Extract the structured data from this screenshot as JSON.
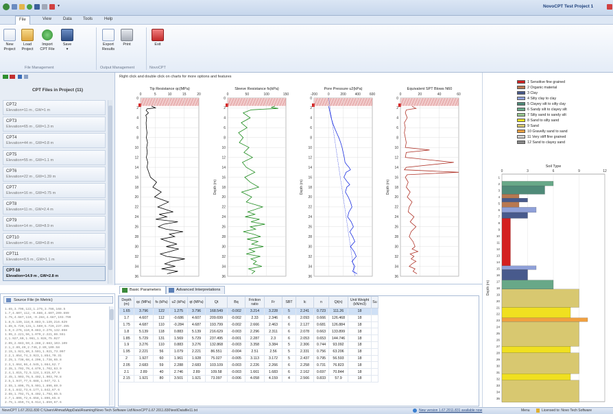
{
  "window": {
    "title": "NovoCPT Test Project 1"
  },
  "menu": [
    "File",
    "View",
    "Data",
    "Tools",
    "Help"
  ],
  "ribbon": {
    "file_management": {
      "label": "File Management",
      "buttons": [
        {
          "line1": "New",
          "line2": "Project"
        },
        {
          "line1": "Load",
          "line2": "Project"
        },
        {
          "line1": "Import",
          "line2": "CPT File"
        },
        {
          "line1": "Save",
          "line2": "▾"
        }
      ]
    },
    "output_management": {
      "label": "Output Management",
      "buttons": [
        {
          "line1": "Export",
          "line2": "Results"
        },
        {
          "line1": "Print",
          "line2": ""
        }
      ]
    },
    "novocpt": {
      "label": "NovoCPT",
      "buttons": [
        {
          "line1": "Exit",
          "line2": ""
        }
      ]
    }
  },
  "left_panel": {
    "title": "CPT Files in Project (11)",
    "files": [
      {
        "name": "CPT2",
        "elevation": "Elevation=11 m , GW=1 m"
      },
      {
        "name": "CPT3",
        "elevation": "Elevation=65 m , GW=1.3 m"
      },
      {
        "name": "CPT4",
        "elevation": "Elevation=44 m , GW=0.8 m"
      },
      {
        "name": "CPT5",
        "elevation": "Elevation=55 m , GW=1.1 m"
      },
      {
        "name": "CPT6",
        "elevation": "Elevation=22 m , GW=1.39 m"
      },
      {
        "name": "CPT7",
        "elevation": "Elevation=16 m , GW=0.75 m"
      },
      {
        "name": "CPT8",
        "elevation": "Elevation=11 m , GW=2.4 m"
      },
      {
        "name": "CPT9",
        "elevation": "Elevation=14 m , GW=8.9 m"
      },
      {
        "name": "CPT10",
        "elevation": "Elevation=16 m , GW=0.8 m"
      },
      {
        "name": "CPT11",
        "elevation": "Elevation=8.5 m , GW=1.1 m"
      },
      {
        "name": "CPT-16",
        "elevation": "Elevation=14.9 m , GW=2.8 m"
      }
    ]
  },
  "source_panel": {
    "title": "Source File (in Metric)",
    "lines": [
      "1.65,3.796,122,1.275,3.786,168.5",
      "1.7,4.607,112,-0.686,4.607,209.699",
      "1.75,4.687,110,-0.284,4.687,193.799",
      "1.8,5.139,118,0.883,5.139,216.629",
      "1.85,5.729,131,1.569,5.729,237.495",
      "1.9,3.276,110,0.883,3.276,132.868",
      "1.95,2.221,56,1.079,2.221,86.551",
      "2,1.927,60,1.961,1.928,75.027",
      "2.05,2.683,59,2.288,2.683,103.109",
      "2.1,2.89,40,2.746,2.89,109.58",
      "2.15,1.921,80,3.501,1.921,73.097",
      "2.2,1.854,74,3.923,1.854,70.31",
      "2.25,1.738,68,4.206,1.738,65.8",
      "2.3,1.664,66,4.545,1.664,62.7",
      "2.35,1.702,70,4.879,1.702,63.9",
      "2.4,1.815,72,5.124,1.815,67.9",
      "2.45,1.903,76,5.402,1.903,70.8",
      "2.5,1.947,77,5.688,1.947,72.1",
      "2.55,1.896,75,5.901,1.896,69.9",
      "2.6,1.842,73,6.177,1.842,67.6",
      "2.65,1.792,71,6.402,1.792,65.5",
      "2.7,1.806,72,6.658,1.806,65.8",
      "2.75,1.859,74,6.914,1.859,67.6",
      "2.8,1.921,77,7.201,1.921,69.7"
    ]
  },
  "chart_hint": "Right click and double click on charts for more options and features",
  "chart_data": [
    {
      "type": "line",
      "title": "Tip Resistance qc(MPa)",
      "xlim": [
        0,
        20
      ],
      "xticks": [
        "0",
        "5",
        "10",
        "15",
        "20"
      ],
      "ylabel": "",
      "ylim": [
        36,
        0
      ],
      "yticks": [
        "0",
        "2",
        "4",
        "6",
        "8",
        "10",
        "12",
        "14",
        "16",
        "18",
        "20",
        "22",
        "24",
        "26",
        "28",
        "30",
        "32",
        "34",
        "36"
      ],
      "color": "#000000",
      "series": [
        {
          "x": [
            3.8,
            4.6,
            5.1,
            2.2,
            1.9,
            2.7,
            1.8,
            2.1,
            1.9,
            2.0,
            2.2,
            2.0,
            2.4,
            2.1,
            2.3,
            2.0,
            2.5,
            2.2,
            2.8,
            3.4,
            5.5,
            4.2,
            7.1,
            4.8,
            9.6,
            5.9,
            11.2,
            6.4,
            9.0,
            5.2,
            12.8,
            7.8,
            6.1,
            8.8,
            14.6,
            9.9,
            11.7,
            7.0,
            9.4,
            12.5,
            8.8,
            13.1,
            10.2,
            6.8,
            9.0,
            15.2,
            10.6,
            8.3,
            11.9,
            7.2,
            12.8,
            9.1
          ],
          "y": [
            1.65,
            1.85,
            2.0,
            2.2,
            2.5,
            3.0,
            3.5,
            4,
            5,
            6,
            7,
            8,
            9,
            10,
            11,
            12,
            13,
            14,
            15,
            16,
            17,
            18,
            19,
            20,
            21,
            22,
            23,
            23.5,
            24,
            24.5,
            25,
            25.5,
            26,
            26.5,
            27,
            27.5,
            28,
            28.5,
            29,
            29.5,
            30,
            30.5,
            31,
            31.5,
            32,
            32.5,
            33,
            33.5,
            34,
            34.5,
            35,
            35.5
          ]
        }
      ]
    },
    {
      "type": "line",
      "title": "Sleeve Resistance fs(kPa)",
      "xlim": [
        0,
        150
      ],
      "xticks": [
        "0",
        "50",
        "100",
        "150"
      ],
      "ylabel": "Depth (m)",
      "ylim": [
        36,
        0
      ],
      "yticks": [
        "0",
        "2",
        "4",
        "6",
        "8",
        "10",
        "12",
        "14",
        "16",
        "18",
        "20",
        "22",
        "24",
        "26",
        "28",
        "30",
        "32",
        "34",
        "36"
      ],
      "color": "#1a8a1a",
      "series": [
        {
          "x": [
            122,
            112,
            130,
            60,
            40,
            58,
            35,
            50,
            28,
            40,
            30,
            55,
            42,
            64,
            38,
            48,
            70,
            44,
            58,
            80,
            36,
            62,
            48,
            90,
            52,
            70,
            45,
            82,
            60,
            96,
            58,
            72,
            40,
            66,
            85,
            50,
            78,
            62,
            92,
            55,
            70,
            48,
            84,
            60,
            74,
            66,
            88,
            54,
            70,
            62
          ],
          "y": [
            1.65,
            1.9,
            2.1,
            2.4,
            3,
            4,
            5,
            6,
            7,
            8,
            9,
            10,
            11,
            12,
            13,
            14,
            15,
            16,
            17,
            18,
            19,
            20,
            21,
            22,
            23,
            23.5,
            24,
            24.5,
            25,
            25.5,
            26,
            26.5,
            27,
            27.5,
            28,
            28.5,
            29,
            29.5,
            30,
            30.5,
            31,
            31.5,
            32,
            32.5,
            33,
            33.5,
            34,
            34.5,
            35,
            35.5
          ]
        }
      ]
    },
    {
      "type": "line",
      "title": "Pore Pressure u2(kPa)",
      "xlim": [
        -200,
        600
      ],
      "xticks": [
        "-200",
        "0",
        "200",
        "400",
        "600"
      ],
      "ylabel": "Depth (m)",
      "ylim": [
        36,
        0
      ],
      "yticks": [
        "0",
        "2",
        "4",
        "6",
        "8",
        "10",
        "12",
        "14",
        "16",
        "18",
        "20",
        "22",
        "24",
        "26",
        "28",
        "30",
        "32",
        "34",
        "36"
      ],
      "color": "#1a2ee0",
      "series": [
        {
          "x": [
            1,
            20,
            35,
            55,
            80,
            110,
            140,
            165,
            185,
            200,
            215,
            225,
            250,
            280,
            300,
            240,
            210,
            260,
            290,
            250,
            230,
            270,
            300,
            320,
            280,
            260,
            310,
            340,
            290,
            330,
            360,
            300,
            350,
            380,
            320,
            360,
            330,
            390
          ],
          "y": [
            1.65,
            3,
            4,
            5,
            6,
            7,
            8,
            9,
            10,
            11,
            12,
            13,
            13.5,
            14,
            14.5,
            15,
            16,
            17,
            17.5,
            18,
            19,
            20,
            21,
            22,
            23,
            24,
            25,
            26,
            27,
            28,
            29,
            30,
            31,
            32,
            33,
            34,
            35,
            35.5
          ]
        },
        {
          "x": [
            0,
            30,
            60,
            90,
            120,
            150,
            180,
            210,
            240,
            270,
            300,
            330,
            360
          ],
          "y": [
            0,
            3,
            6,
            9,
            12,
            15,
            18,
            21,
            24,
            27,
            30,
            33,
            36
          ]
        }
      ]
    },
    {
      "type": "line",
      "title": "Equivalent SPT Blows N60",
      "xlim": [
        0,
        60
      ],
      "xticks": [
        "0",
        "20",
        "40",
        "60"
      ],
      "ylabel": "Depth (m)",
      "ylim": [
        36,
        0
      ],
      "yticks": [
        "0",
        "2",
        "4",
        "6",
        "8",
        "10",
        "12",
        "14",
        "16",
        "18",
        "20",
        "22",
        "24",
        "26",
        "28",
        "30",
        "32",
        "34",
        "36"
      ],
      "color": "#b0352a",
      "series": [
        {
          "x": [
            12,
            14,
            16,
            6,
            5,
            7,
            4,
            5,
            4,
            5,
            6,
            5,
            30,
            6,
            5,
            55,
            6,
            4,
            60,
            7,
            5,
            8,
            6,
            10,
            7,
            12,
            9,
            8,
            14,
            10,
            16,
            11,
            9,
            13,
            15,
            12,
            18,
            10,
            14,
            11,
            16,
            12,
            9,
            15,
            13,
            17
          ],
          "y": [
            1.65,
            1.9,
            2.1,
            2.4,
            3,
            4,
            5,
            6,
            7,
            8,
            9,
            10,
            10.5,
            11,
            12,
            13,
            14,
            14.5,
            15,
            15.5,
            16,
            17,
            18,
            19,
            20,
            21,
            22,
            23,
            24,
            25,
            26,
            27,
            28,
            29,
            30,
            30.5,
            31,
            31.5,
            32,
            32.5,
            33,
            33.5,
            34,
            34.5,
            35,
            35.5
          ]
        }
      ]
    }
  ],
  "soil_legend": [
    {
      "label": "1 Sensitive fine grained",
      "color": "#d42020"
    },
    {
      "label": "2 Organic material",
      "color": "#b87850"
    },
    {
      "label": "3 Clay",
      "color": "#485a8c"
    },
    {
      "label": "4 Silty clay to clay",
      "color": "#8fa0d8"
    },
    {
      "label": "5 Clayey silt to silty clay",
      "color": "#4f8a78"
    },
    {
      "label": "6 Sandy silt to clayey silt",
      "color": "#68a888"
    },
    {
      "label": "7 Silty sand to sandy silt",
      "color": "#98c890"
    },
    {
      "label": "8 Sand to silty sand",
      "color": "#f0e020"
    },
    {
      "label": "9 Sand",
      "color": "#d8c870"
    },
    {
      "label": "10 Gravelly sand to sand",
      "color": "#f0a040"
    },
    {
      "label": "11 Very stiff fine grained",
      "color": "#d0d0d0"
    },
    {
      "label": "12 Sand to clayey sand",
      "color": "#888888"
    }
  ],
  "soil_chart": {
    "title": "Soil Type",
    "xticks": [
      "0",
      "3",
      "6",
      "9",
      "12"
    ],
    "ylabel": "Depth (m)",
    "yticks": [
      "1",
      "2",
      "3",
      "4",
      "5",
      "6",
      "7",
      "8",
      "9",
      "10",
      "11",
      "12",
      "13",
      "14",
      "15",
      "16",
      "17",
      "18",
      "19",
      "20",
      "21",
      "22",
      "23",
      "24",
      "25",
      "26",
      "27",
      "28",
      "29",
      "30",
      "31",
      "32",
      "33",
      "34",
      "35"
    ],
    "layers": [
      {
        "top": 1.6,
        "bottom": 2.3,
        "type": 6
      },
      {
        "top": 2.3,
        "bottom": 3.6,
        "type": 5
      },
      {
        "top": 3.6,
        "bottom": 4.2,
        "type": 2
      },
      {
        "top": 4.2,
        "bottom": 4.8,
        "type": 3
      },
      {
        "top": 4.8,
        "bottom": 5.6,
        "type": 2
      },
      {
        "top": 5.6,
        "bottom": 6.4,
        "type": 4
      },
      {
        "top": 6.4,
        "bottom": 7.3,
        "type": 3
      },
      {
        "top": 7.3,
        "bottom": 14.6,
        "type": 1
      },
      {
        "top": 14.6,
        "bottom": 15.2,
        "type": 4
      },
      {
        "top": 15.2,
        "bottom": 16.8,
        "type": 3
      },
      {
        "top": 16.8,
        "bottom": 18.2,
        "type": 6
      },
      {
        "top": 18.2,
        "bottom": 21.0,
        "type": 9
      },
      {
        "top": 21.0,
        "bottom": 22.6,
        "type": 8
      },
      {
        "top": 22.6,
        "bottom": 23.2,
        "type": 10
      },
      {
        "top": 23.2,
        "bottom": 27.0,
        "type": 9
      },
      {
        "top": 27.0,
        "bottom": 28.0,
        "type": 8
      },
      {
        "top": 28.0,
        "bottom": 31.2,
        "type": 9
      },
      {
        "top": 31.2,
        "bottom": 32.2,
        "type": 8
      },
      {
        "top": 32.2,
        "bottom": 35.6,
        "type": 9
      }
    ]
  },
  "tabs": [
    "Basic Parameters",
    "Advanced Interpretations"
  ],
  "table": {
    "headers": [
      "Depth (m)",
      "qc (MPa)",
      "fs (kPa)",
      "u2 (kPa)",
      "qt (MPa)",
      "Qt",
      "Bq",
      "Friction ratio",
      "Fr",
      "SBT",
      "Ic",
      "n",
      "Qt(n)",
      "Unit Weight (kN/m3)",
      "Su"
    ],
    "rows": [
      [
        "1.65",
        "3.796",
        "122",
        "1.275",
        "3.796",
        "168.549",
        "-0.002",
        "3.214",
        "3.228",
        "5",
        "2.241",
        "0.723",
        "111.26",
        "18",
        ""
      ],
      [
        "1.7",
        "4.607",
        "112",
        "-0.686",
        "4.607",
        "209.699",
        "-0.002",
        "2.33",
        "2.346",
        "6",
        "2.093",
        "0.666",
        "126.468",
        "18",
        ""
      ],
      [
        "1.75",
        "4.687",
        "110",
        "-0.284",
        "4.687",
        "193.799",
        "-0.002",
        "2.666",
        "2.463",
        "6",
        "2.127",
        "0.681",
        "126.884",
        "18",
        ""
      ],
      [
        "1.8",
        "5.139",
        "118",
        "0.883",
        "5.139",
        "216.629",
        "-0.003",
        "2.296",
        "2.311",
        "6",
        "2.078",
        "0.663",
        "133.899",
        "18",
        ""
      ],
      [
        "1.85",
        "5.729",
        "131",
        "1.569",
        "5.729",
        "237.495",
        "-0.001",
        "2.287",
        "2.3",
        "6",
        "2.053",
        "0.653",
        "144.746",
        "18",
        ""
      ],
      [
        "1.9",
        "3.276",
        "110",
        "0.883",
        "3.276",
        "132.868",
        "-0.003",
        "3.358",
        "3.384",
        "5",
        "2.306",
        "0.744",
        "93.092",
        "18",
        ""
      ],
      [
        "1.95",
        "2.221",
        "56",
        "1.079",
        "2.221",
        "86.551",
        "-0.004",
        "2.51",
        "2.56",
        "5",
        "2.331",
        "0.756",
        "63.206",
        "18",
        ""
      ],
      [
        "2",
        "1.927",
        "60",
        "1.961",
        "1.928",
        "75.027",
        "-0.005",
        "3.113",
        "3.172",
        "5",
        "2.437",
        "0.795",
        "56.593",
        "18",
        ""
      ],
      [
        "2.05",
        "2.683",
        "59",
        "2.288",
        "2.683",
        "103.109",
        "-0.003",
        "2.226",
        "2.266",
        "6",
        "2.258",
        "0.731",
        "76.823",
        "18",
        ""
      ],
      [
        "2.1",
        "2.89",
        "40",
        "2.746",
        "2.89",
        "109.58",
        "-0.003",
        "1.661",
        "1.683",
        "6",
        "2.162",
        "0.697",
        "70.844",
        "18",
        ""
      ],
      [
        "2.15",
        "1.921",
        "80",
        "3.501",
        "1.921",
        "73.097",
        "-0.006",
        "4.058",
        "4.159",
        "4",
        "2.566",
        "0.833",
        "57.9",
        "18",
        ""
      ]
    ]
  },
  "status": {
    "left": "NovoCPT 1.67.2011.830   C:\\Users\\Ahmad\\AppData\\Roaming\\Novo Tech Software Ltd\\NovoCPT\\1.67.2011.830\\test\\Datafile11.txt",
    "update": "New version 1.67.2011.831 available now",
    "menu": "Menu",
    "license": "Licensed to: Novo Tech Software"
  }
}
